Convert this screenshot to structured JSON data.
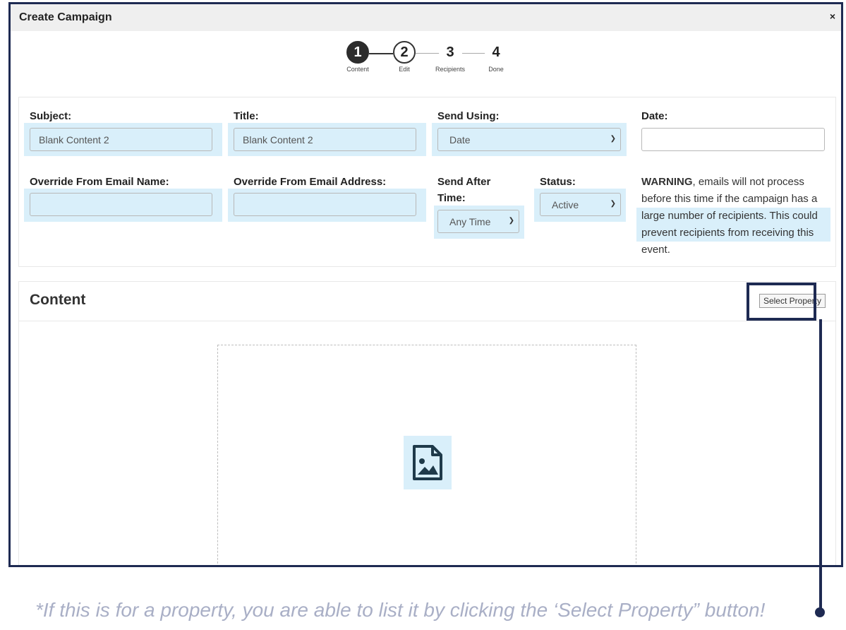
{
  "window": {
    "title": "Create Campaign",
    "close_glyph": "×"
  },
  "stepper": [
    {
      "number": "1",
      "label": "Content",
      "state": "active"
    },
    {
      "number": "2",
      "label": "Edit",
      "state": "normal"
    },
    {
      "number": "3",
      "label": "Recipients",
      "state": "inactive"
    },
    {
      "number": "4",
      "label": "Done",
      "state": "inactive"
    }
  ],
  "form": {
    "subject": {
      "label": "Subject:",
      "value": "Blank Content 2"
    },
    "title": {
      "label": "Title:",
      "value": "Blank Content 2"
    },
    "send_using": {
      "label": "Send Using:",
      "value": "Date"
    },
    "date": {
      "label": "Date:",
      "value": ""
    },
    "override_name": {
      "label": "Override From Email Name:",
      "value": ""
    },
    "override_address": {
      "label": "Override From Email Address:",
      "value": ""
    },
    "send_after": {
      "label_line1": "Send After",
      "label_line2": "Time:",
      "value": "Any Time"
    },
    "status": {
      "label": "Status:",
      "value": "Active"
    },
    "warning": {
      "bold": "WARNING",
      "text": ", emails will not process before this time if the campaign has a large number of recipients. This could prevent recipients from receiving this event."
    }
  },
  "content": {
    "title": "Content",
    "select_property_label": "Select Property",
    "image_placeholder_icon": "image-file-icon"
  },
  "note": "*If this is for a property, you are able to list it by clicking the ‘Select Property” button!",
  "colors": {
    "frame": "#1e2a52",
    "highlight": "#d9effa",
    "note": "#a9afc6"
  }
}
